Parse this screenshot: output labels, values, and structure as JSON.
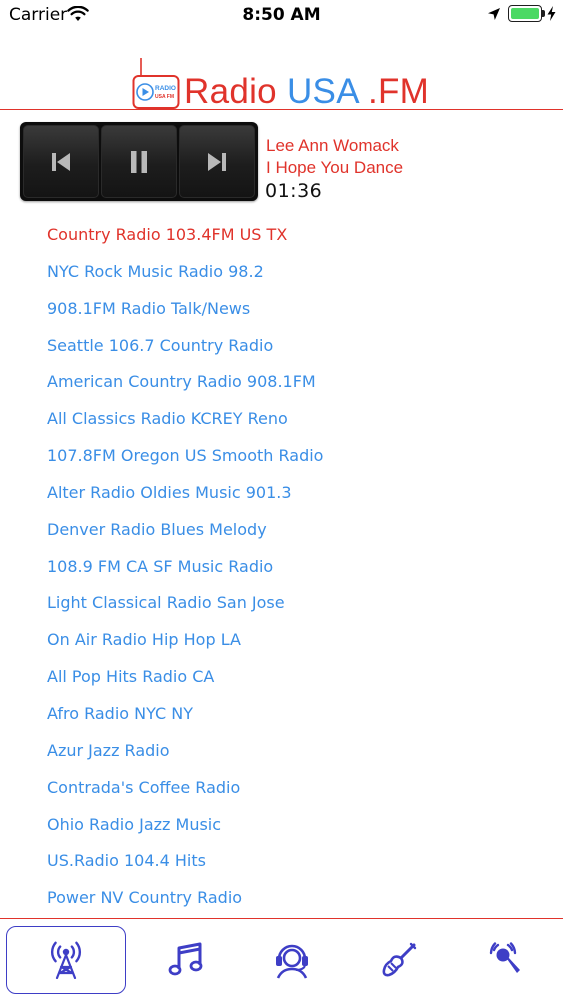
{
  "status_bar": {
    "carrier": "Carrier",
    "time": "8:50 AM",
    "battery_color": "#4cd964",
    "icons": [
      "wifi-icon",
      "location-arrow-icon",
      "battery-icon",
      "charging-bolt-icon"
    ]
  },
  "header": {
    "logo_icon": "radio-logo-icon",
    "logo_text_top": "RADIO",
    "logo_text_bottom": "USA FM",
    "title_part1": "Radio ",
    "title_part2": "USA",
    "title_part3": " .FM",
    "accent_red": "#e0332b",
    "accent_blue": "#3a8ee6"
  },
  "player": {
    "controls": [
      "previous-icon",
      "pause-icon",
      "next-icon"
    ],
    "artist": "Lee Ann Womack",
    "song": "I Hope You Dance",
    "elapsed": "01:36"
  },
  "stations": [
    "Country Radio 103.4FM US TX",
    "NYC Rock Music Radio 98.2",
    "908.1FM Radio Talk/News",
    "Seattle 106.7 Country Radio",
    "American Country Radio 908.1FM",
    "All Classics Radio KCREY Reno",
    "107.8FM Oregon US Smooth Radio",
    "Alter Radio Oldies Music 901.3",
    "Denver Radio Blues Melody",
    "108.9 FM CA SF Music Radio",
    "Light Classical Radio San Jose",
    "On Air Radio Hip Hop LA",
    "All Pop Hits Radio CA",
    "Afro Radio NYC NY",
    "Azur Jazz Radio",
    "Contrada's Coffee Radio",
    "Ohio Radio Jazz Music",
    "US.Radio 104.4 Hits",
    "Power NV Country Radio"
  ],
  "active_station_index": 0,
  "tabbar": {
    "icon_color": "#3e3ec6",
    "tabs": [
      "radio-tower-icon",
      "music-notes-icon",
      "headset-icon",
      "guitar-icon",
      "microphone-icon"
    ],
    "selected_index": 0
  }
}
